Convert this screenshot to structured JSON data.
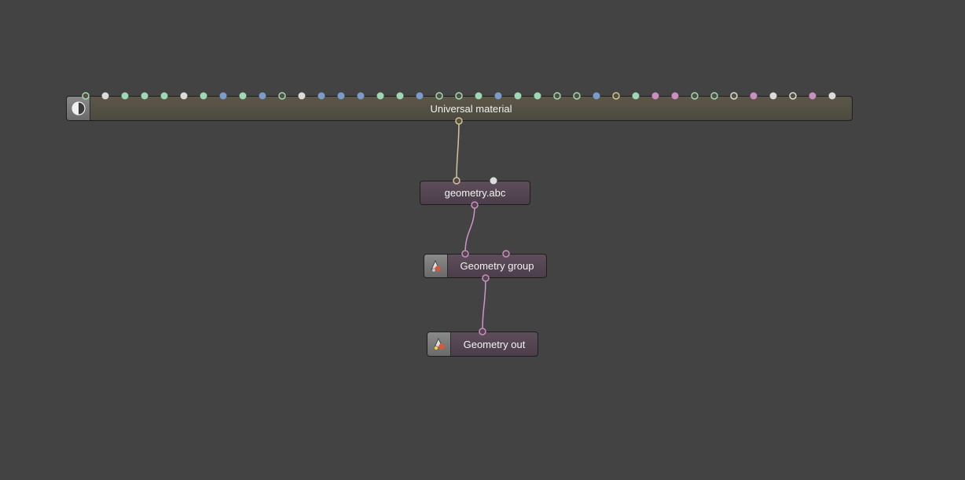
{
  "nodes": {
    "universal_material": {
      "label": "Universal material"
    },
    "geometry_abc": {
      "label": "geometry.abc"
    },
    "geometry_group": {
      "label": "Geometry group"
    },
    "geometry_out": {
      "label": "Geometry out"
    }
  },
  "colors": {
    "background": "#434343",
    "material_node": "#55513f",
    "geometry_node": "#554553",
    "pin_green": "#9fd8b4",
    "pin_white": "#dcdcdc",
    "pin_blue": "#7b9bc9",
    "pin_pink": "#c88fc0",
    "pin_tan": "#cfc38e",
    "link_material": "#cfc69a",
    "link_geometry": "#c996c7"
  },
  "material_pins": [
    {
      "color": "#9fd8b4",
      "style": "hollow"
    },
    {
      "color": "#dcdcdc",
      "style": "filled"
    },
    {
      "color": "#9fd8b4",
      "style": "filled"
    },
    {
      "color": "#9fd8b4",
      "style": "filled"
    },
    {
      "color": "#9fd8b4",
      "style": "filled"
    },
    {
      "color": "#dcdcdc",
      "style": "filled"
    },
    {
      "color": "#9fd8b4",
      "style": "filled"
    },
    {
      "color": "#7b9bc9",
      "style": "filled"
    },
    {
      "color": "#9fd8b4",
      "style": "filled"
    },
    {
      "color": "#7b9bc9",
      "style": "filled"
    },
    {
      "color": "#9fd8b4",
      "style": "hollow"
    },
    {
      "color": "#dcdcdc",
      "style": "filled"
    },
    {
      "color": "#7b9bc9",
      "style": "filled"
    },
    {
      "color": "#7b9bc9",
      "style": "filled"
    },
    {
      "color": "#7b9bc9",
      "style": "filled"
    },
    {
      "color": "#9fd8b4",
      "style": "filled"
    },
    {
      "color": "#9fd8b4",
      "style": "filled"
    },
    {
      "color": "#7b9bc9",
      "style": "filled"
    },
    {
      "color": "#9fd8b4",
      "style": "hollow"
    },
    {
      "color": "#9fd8b4",
      "style": "hollow"
    },
    {
      "color": "#9fd8b4",
      "style": "filled"
    },
    {
      "color": "#7b9bc9",
      "style": "filled"
    },
    {
      "color": "#9fd8b4",
      "style": "filled"
    },
    {
      "color": "#9fd8b4",
      "style": "filled"
    },
    {
      "color": "#9fd8b4",
      "style": "hollow"
    },
    {
      "color": "#9fd8b4",
      "style": "hollow"
    },
    {
      "color": "#7b9bc9",
      "style": "filled"
    },
    {
      "color": "#cfc38e",
      "style": "hollow"
    },
    {
      "color": "#9fd8b4",
      "style": "filled"
    },
    {
      "color": "#c88fc0",
      "style": "filled"
    },
    {
      "color": "#c88fc0",
      "style": "filled"
    },
    {
      "color": "#9fd8b4",
      "style": "hollow"
    },
    {
      "color": "#9fd8b4",
      "style": "hollow"
    },
    {
      "color": "#dcdcdc",
      "style": "hollow"
    },
    {
      "color": "#c88fc0",
      "style": "filled"
    },
    {
      "color": "#dcdcdc",
      "style": "filled"
    },
    {
      "color": "#dcdcdc",
      "style": "hollow"
    },
    {
      "color": "#c88fc0",
      "style": "filled"
    },
    {
      "color": "#dcdcdc",
      "style": "filled"
    }
  ],
  "icons": {
    "material": "sphere-material-icon",
    "geometry_group": "geometry-group-icon",
    "geometry_out": "geometry-out-icon"
  }
}
